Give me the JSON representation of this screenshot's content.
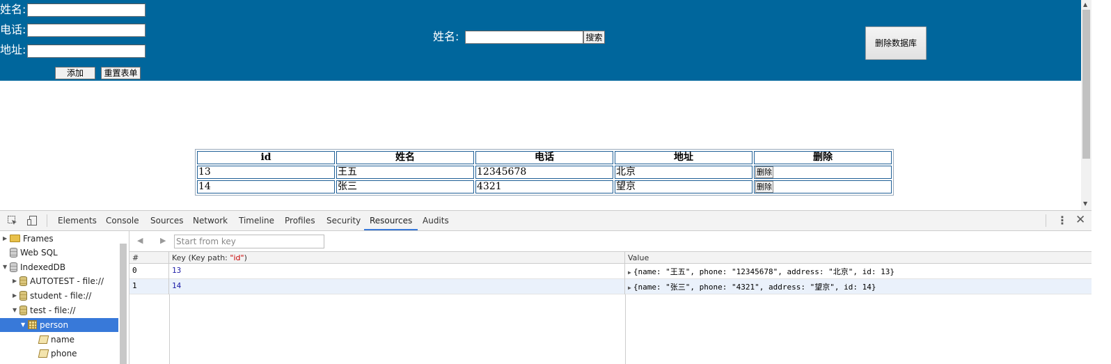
{
  "form": {
    "name_label": "姓名:",
    "phone_label": "电话:",
    "address_label": "地址:",
    "add_button": "添加",
    "reset_button": "重置表单"
  },
  "search": {
    "label": "姓名:",
    "button": "搜索"
  },
  "delete_db_button": "删除数据库",
  "table": {
    "headers": [
      "id",
      "姓名",
      "电话",
      "地址",
      "删除"
    ],
    "rows": [
      {
        "id": "13",
        "name": "王五",
        "phone": "12345678",
        "address": "北京",
        "action": "删除"
      },
      {
        "id": "14",
        "name": "张三",
        "phone": "4321",
        "address": "望京",
        "action": "删除"
      }
    ]
  },
  "devtools": {
    "tabs": [
      "Elements",
      "Console",
      "Sources",
      "Network",
      "Timeline",
      "Profiles",
      "Security",
      "Resources",
      "Audits"
    ],
    "active_tab": "Resources",
    "tree": [
      {
        "label": "Frames"
      },
      {
        "label": "Web SQL"
      },
      {
        "label": "IndexedDB"
      },
      {
        "label": "AUTOTEST - file://"
      },
      {
        "label": "student - file://"
      },
      {
        "label": "test - file://"
      },
      {
        "label": "person"
      },
      {
        "label": "name"
      },
      {
        "label": "phone"
      }
    ],
    "start_key_placeholder": "Start from key",
    "columns": {
      "index": "#",
      "key_prefix": "Key (Key path: ",
      "key_path": "\"id\"",
      "key_suffix": ")",
      "value": "Value"
    },
    "records": [
      {
        "index": "0",
        "key": "13",
        "value": "{name: \"王五\", phone: \"12345678\", address: \"北京\", id: 13}"
      },
      {
        "index": "1",
        "key": "14",
        "value": "{name: \"张三\", phone: \"4321\", address: \"望京\", id: 14}"
      }
    ]
  },
  "colors": {
    "header_bg": "#00669c",
    "table_border": "#1f5f96",
    "devtools_accent": "#3879d9"
  }
}
